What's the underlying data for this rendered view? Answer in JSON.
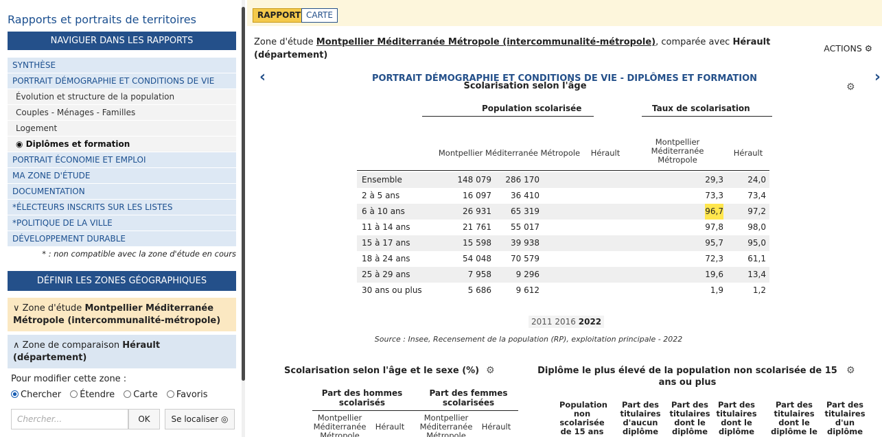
{
  "left": {
    "app_title": "Rapports et portraits de territoires",
    "nav_header": "NAVIGUER DANS LES RAPPORTS",
    "nav_items": [
      {
        "label": "SYNTHÈSE",
        "type": "top"
      },
      {
        "label": "PORTRAIT DÉMOGRAPHIE ET CONDITIONS DE VIE",
        "type": "top"
      },
      {
        "label": "Évolution et structure de la population",
        "type": "sub"
      },
      {
        "label": "Couples - Ménages - Familles",
        "type": "sub"
      },
      {
        "label": "Logement",
        "type": "sub"
      },
      {
        "label": "Diplômes et formation",
        "type": "sub-active"
      },
      {
        "label": "PORTRAIT ÉCONOMIE ET EMPLOI",
        "type": "top"
      },
      {
        "label": "MA ZONE D'ÉTUDE",
        "type": "top"
      },
      {
        "label": "DOCUMENTATION",
        "type": "top"
      },
      {
        "label": "*ÉLECTEURS INSCRITS SUR LES LISTES",
        "type": "top"
      },
      {
        "label": "*POLITIQUE DE LA VILLE",
        "type": "top"
      },
      {
        "label": "DÉVELOPPEMENT DURABLE",
        "type": "top"
      }
    ],
    "nav_note": "* : non compatible avec la zone d'étude en cours",
    "zones_header": "DÉFINIR LES ZONES GÉOGRAPHIQUES",
    "zone_etude_prefix": "Zone d'étude",
    "zone_etude_name": "Montpellier Méditerranée Métropole (intercommunalité-métropole)",
    "zone_comp_prefix": "Zone de comparaison",
    "zone_comp_name": "Hérault (département)",
    "modify_label": "Pour modifier cette zone :",
    "radios": [
      "Chercher",
      "Étendre",
      "Carte",
      "Favoris"
    ],
    "search_placeholder": "Chercher...",
    "ok_label": "OK",
    "locate_label": "Se localiser"
  },
  "main": {
    "tabs": {
      "rapport": "RAPPORT",
      "carte": "CARTE"
    },
    "zone_prefix": "Zone d'étude",
    "zone_name": "Montpellier Méditerranée Métropole (intercommunalité-métropole)",
    "zone_compare": ", comparée avec",
    "zone_compare_name": "Hérault (département)",
    "actions_label": "ACTIONS",
    "section_title": "PORTRAIT DÉMOGRAPHIE ET CONDITIONS DE VIE - DIPLÔMES ET FORMATION",
    "table_title": "Scolarisation selon l'âge",
    "group_pop": "Population scolarisée",
    "group_taux": "Taux de scolarisation",
    "col_mmm": "Montpellier Méditerranée Métropole",
    "col_herault": "Hérault",
    "col_mmm_multi": "Montpellier Méditerranée Métropole",
    "col_herault2": "Hérault",
    "rows": [
      {
        "label": "Ensemble",
        "pop_mmm": "148 079",
        "pop_her": "286 170",
        "taux_mmm": "29,3",
        "taux_her": "24,0"
      },
      {
        "label": "2 à 5 ans",
        "pop_mmm": "16 097",
        "pop_her": "36 410",
        "taux_mmm": "73,3",
        "taux_her": "73,4"
      },
      {
        "label": "6 à 10 ans",
        "pop_mmm": "26 931",
        "pop_her": "65 319",
        "taux_mmm": "96,7",
        "taux_her": "97,2"
      },
      {
        "label": "11 à 14 ans",
        "pop_mmm": "21 761",
        "pop_her": "55 017",
        "taux_mmm": "97,8",
        "taux_her": "98,0"
      },
      {
        "label": "15 à 17 ans",
        "pop_mmm": "15 598",
        "pop_her": "39 938",
        "taux_mmm": "95,7",
        "taux_her": "95,0"
      },
      {
        "label": "18 à 24 ans",
        "pop_mmm": "54 048",
        "pop_her": "70 579",
        "taux_mmm": "72,3",
        "taux_her": "61,1"
      },
      {
        "label": "25 à 29 ans",
        "pop_mmm": "7 958",
        "pop_her": "9 296",
        "taux_mmm": "19,6",
        "taux_her": "13,4"
      },
      {
        "label": "30 ans ou plus",
        "pop_mmm": "5 686",
        "pop_her": "9 612",
        "taux_mmm": "1,9",
        "taux_her": "1,2"
      }
    ],
    "years": [
      "2011",
      "2016",
      "2022"
    ],
    "source": "Source : Insee, Recensement de la population (RP), exploitation principale - 2022",
    "sub1_title": "Scolarisation selon l'âge et le sexe (%)",
    "sub1_head_h": "Part des hommes scolarisés",
    "sub1_head_f": "Part des femmes scolarisées",
    "sub1_col_mmm": "Montpellier Méditerranée Métropole",
    "sub1_col_her": "Hérault",
    "sub2_title": "Diplôme le plus élevé de la population non scolarisée de 15 ans ou plus",
    "sub2_cols": [
      "Population non scolarisée de 15 ans",
      "Part des titulaires d'aucun diplôme",
      "Part des titulaires dont le diplôme",
      "Part des titulaires dont le diplôme",
      "Part des titulaires dont le diplôme le",
      "Part des titulaires d'un diplôme"
    ]
  }
}
